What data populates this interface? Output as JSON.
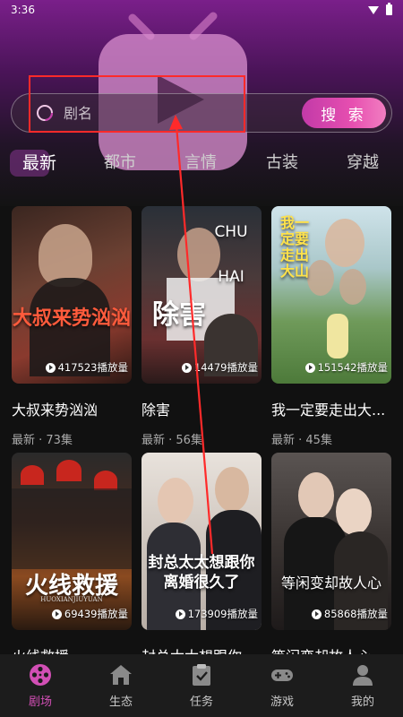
{
  "status_bar": {
    "time": "3:36"
  },
  "search": {
    "placeholder": "剧名",
    "button_label": "搜 索"
  },
  "tabs": [
    {
      "label": "最新",
      "active": true
    },
    {
      "label": "都市"
    },
    {
      "label": "言情"
    },
    {
      "label": "古装"
    },
    {
      "label": "穿越"
    }
  ],
  "dramas": [
    {
      "poster_text": "大叔来势汹汹",
      "views": "417523播放量",
      "title": "大叔来势汹汹",
      "meta": "最新 · 73集"
    },
    {
      "poster_text": "除害",
      "poster_caption": "CHU HAI",
      "views": "14479播放量",
      "title": "除害",
      "meta": "最新 · 56集"
    },
    {
      "poster_text": "我一定要走出大山",
      "views": "151542播放量",
      "title": "我一定要走出大...",
      "meta": "最新 · 45集"
    },
    {
      "poster_text": "火线救援",
      "poster_caption": "HUOXIANJIUYUAN",
      "views": "69439播放量",
      "title": "火线救援",
      "meta": ""
    },
    {
      "poster_text": "封总太太想跟你离婚很久了",
      "views": "173909播放量",
      "title": "封总太太想跟你",
      "meta": ""
    },
    {
      "poster_text": "等闲变却故人心",
      "views": "85868播放量",
      "title": "等闲变却故人心",
      "meta": ""
    }
  ],
  "bottom_nav": [
    {
      "label": "剧场",
      "icon": "film-reel-icon",
      "active": true
    },
    {
      "label": "生态",
      "icon": "house-icon"
    },
    {
      "label": "任务",
      "icon": "clipboard-check-icon"
    },
    {
      "label": "游戏",
      "icon": "gamepad-icon"
    },
    {
      "label": "我的",
      "icon": "person-icon"
    }
  ],
  "colors": {
    "accent": "#d24fb5",
    "annotation": "#ff2a2a"
  }
}
